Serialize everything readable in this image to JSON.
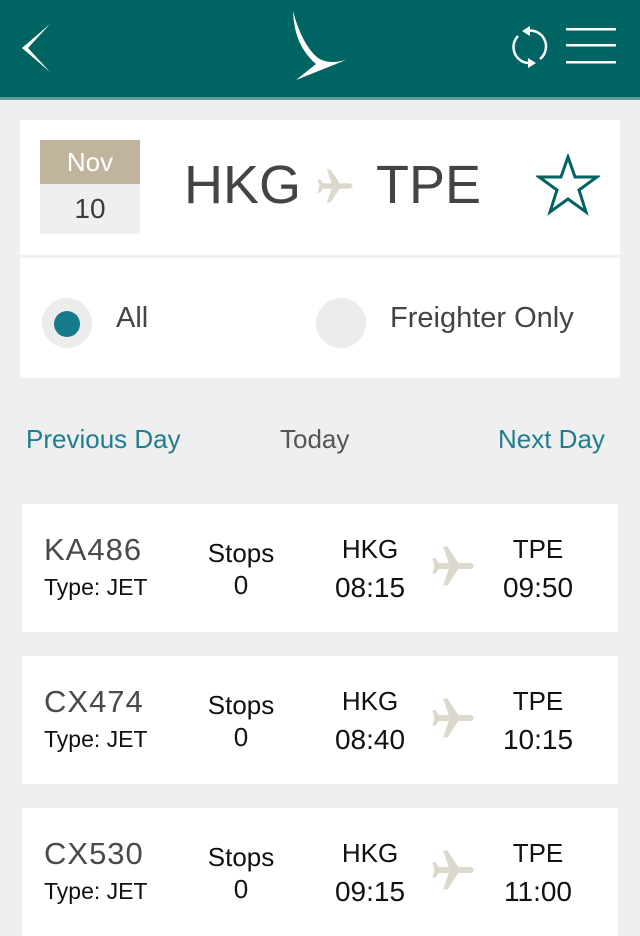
{
  "header": {
    "back_icon": "chevron-left-icon",
    "logo_icon": "brushwing-logo-icon",
    "refresh_icon": "refresh-icon",
    "menu_icon": "hamburger-menu-icon",
    "bg_color": "#006462"
  },
  "route": {
    "month": "Nov",
    "day": "10",
    "origin": "HKG",
    "destination": "TPE",
    "favorite_icon": "star-outline-icon"
  },
  "filter": {
    "options": [
      {
        "label": "All",
        "selected": true
      },
      {
        "label": "Freighter Only",
        "selected": false
      }
    ]
  },
  "day_nav": {
    "previous": "Previous Day",
    "today": "Today",
    "next": "Next Day"
  },
  "flights": [
    {
      "number": "KA486",
      "type": "Type: JET",
      "stops_label": "Stops",
      "stops": "0",
      "from": "HKG",
      "depart": "08:15",
      "to": "TPE",
      "arrive": "09:50"
    },
    {
      "number": "CX474",
      "type": "Type: JET",
      "stops_label": "Stops",
      "stops": "0",
      "from": "HKG",
      "depart": "08:40",
      "to": "TPE",
      "arrive": "10:15"
    },
    {
      "number": "CX530",
      "type": "Type: JET",
      "stops_label": "Stops",
      "stops": "0",
      "from": "HKG",
      "depart": "09:15",
      "to": "TPE",
      "arrive": "11:00"
    }
  ],
  "colors": {
    "brand": "#006462",
    "accent": "#167c8c",
    "gold": "#c0b49c",
    "plane": "#ddd8cc"
  }
}
